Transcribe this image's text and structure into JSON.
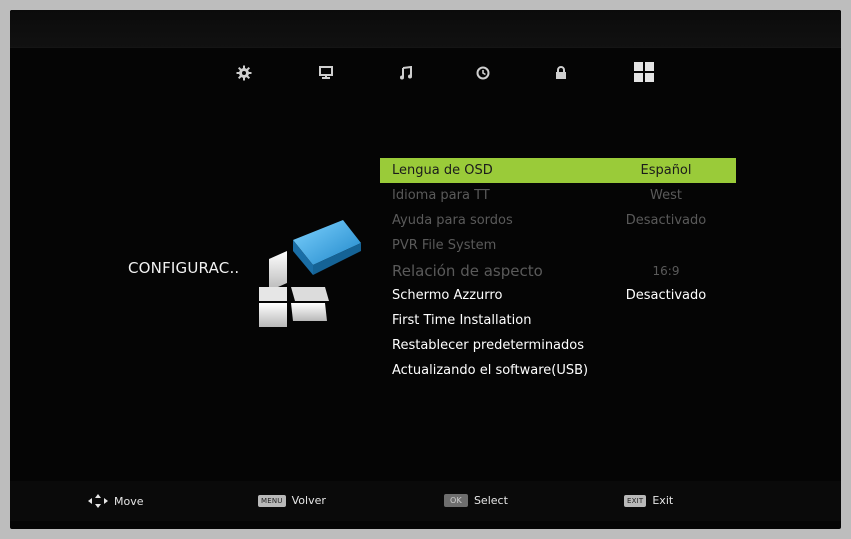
{
  "menu_tabs": [
    {
      "icon": "gear-icon",
      "id": "tab-setup"
    },
    {
      "icon": "monitor-icon",
      "id": "tab-picture"
    },
    {
      "icon": "music-note-icon",
      "id": "tab-sound"
    },
    {
      "icon": "clock-icon",
      "id": "tab-time"
    },
    {
      "icon": "lock-icon",
      "id": "tab-lock"
    },
    {
      "icon": "grid-icon",
      "id": "tab-setup-active"
    }
  ],
  "section_label": "CONFIGURAC..",
  "menu": {
    "items": [
      {
        "label": "Lengua de OSD",
        "value": "Español"
      },
      {
        "label": "Idioma para TT",
        "value": "West"
      },
      {
        "label": "Ayuda para sordos",
        "value": "Desactivado"
      },
      {
        "label": "PVR File System",
        "value": ""
      },
      {
        "label": "Relación de aspecto",
        "value": "16:9"
      },
      {
        "label": "Schermo Azzurro",
        "value": "Desactivado"
      },
      {
        "label": "First Time Installation",
        "value": ""
      },
      {
        "label": "Restablecer predeterminados",
        "value": ""
      },
      {
        "label": "Actualizando el software(USB)",
        "value": ""
      }
    ]
  },
  "footer": {
    "move_label": "Move",
    "menu_key": "MENU",
    "back_label": "Volver",
    "ok_key": "OK",
    "select_label": "Select",
    "exit_key": "EXIT",
    "exit_label": "Exit"
  },
  "colors": {
    "highlight": "#9acb39",
    "active_tab": "#e0e0e0"
  }
}
